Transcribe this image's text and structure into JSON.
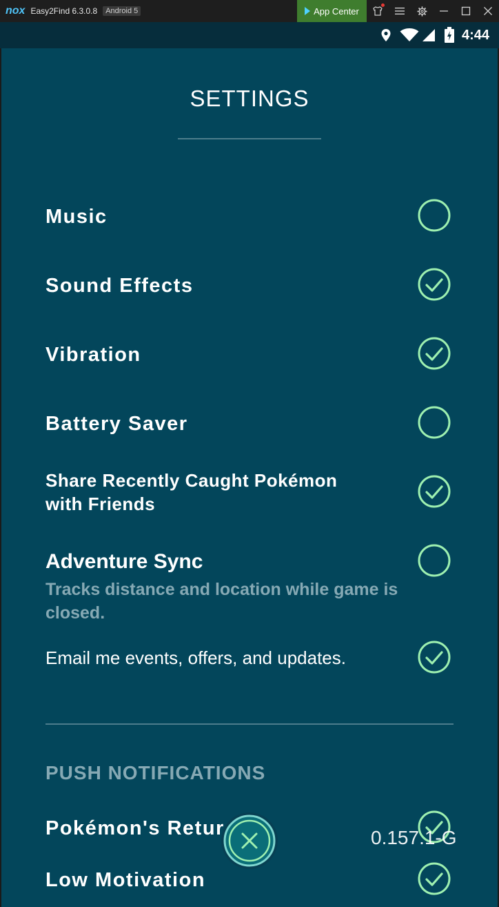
{
  "emulator": {
    "logo": "nox",
    "app_title": "Easy2Find 6.3.0.8",
    "android_badge": "Android 5",
    "app_center_label": "App Center",
    "icons": [
      "shirt-icon",
      "menu-icon",
      "gear-icon",
      "minimize-icon",
      "maximize-icon",
      "close-icon"
    ]
  },
  "statusbar": {
    "time": "4:44",
    "icons": [
      "location-icon",
      "wifi-icon",
      "signal-icon",
      "battery-icon"
    ]
  },
  "settings": {
    "title": "SETTINGS",
    "items": [
      {
        "label": "Music",
        "checked": false
      },
      {
        "label": "Sound Effects",
        "checked": true
      },
      {
        "label": "Vibration",
        "checked": true
      },
      {
        "label": "Battery Saver",
        "checked": false
      },
      {
        "label_line1": "Share Recently Caught Pokémon",
        "label_line2": "with Friends",
        "checked": true
      },
      {
        "label": "Adventure Sync",
        "description": "Tracks distance and location while game is closed.",
        "checked": false
      },
      {
        "label": "Email me events, offers, and updates.",
        "checked": true
      }
    ]
  },
  "push_notifications": {
    "title": "PUSH NOTIFICATIONS",
    "items": [
      {
        "label": "Pokémon's Retur",
        "checked": true
      },
      {
        "label": "Low Motivation",
        "checked": true
      }
    ]
  },
  "overlay_text": "0.157.1-G",
  "colors": {
    "background": "#03465b",
    "accent": "#9ef0b0",
    "muted_text": "#86a9b4",
    "close_button": "#0a6e78"
  }
}
